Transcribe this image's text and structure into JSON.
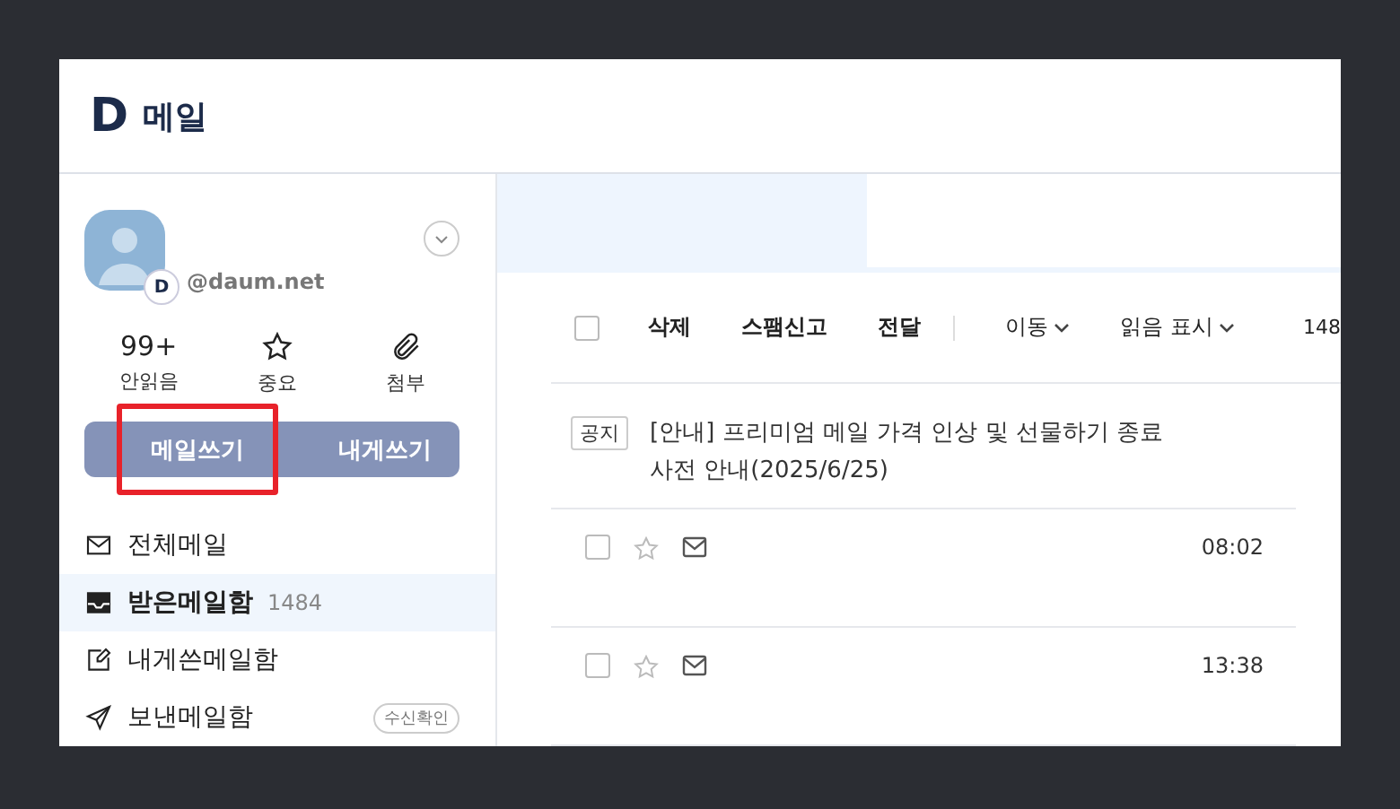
{
  "header": {
    "logo": "D",
    "title": "메일"
  },
  "profile": {
    "email": "@daum.net",
    "badge": "D"
  },
  "stats": [
    {
      "kind": "count",
      "value": "99+",
      "label": "안읽음"
    },
    {
      "kind": "star",
      "label": "중요"
    },
    {
      "kind": "clip",
      "label": "첨부"
    }
  ],
  "compose_buttons": [
    {
      "label": "메일쓰기",
      "highlighted": true
    },
    {
      "label": "내게쓰기",
      "highlighted": false
    }
  ],
  "folders": [
    {
      "kind": "mail",
      "label": "전체메일",
      "selected": false
    },
    {
      "kind": "inbox",
      "label": "받은메일함",
      "count": "1484",
      "selected": true
    },
    {
      "kind": "note",
      "label": "내게쓴메일함",
      "selected": false
    },
    {
      "kind": "send",
      "label": "보낸메일함",
      "badge": "수신확인",
      "selected": false
    }
  ],
  "toolbar": {
    "select_all_checked": false,
    "actions": [
      {
        "label": "삭제",
        "dropdown": false
      },
      {
        "label": "스팸신고",
        "dropdown": false
      },
      {
        "label": "전달",
        "dropdown": false
      },
      {
        "label": "이동",
        "dropdown": true
      },
      {
        "label": "읽음 표시",
        "dropdown": true
      }
    ],
    "count": "148"
  },
  "notice": {
    "tag": "공지",
    "text": "[안내] 프리미엄 메일 가격 인상 및 선물하기 종료 사전 안내(2025/6/25)"
  },
  "messages": [
    {
      "checked": false,
      "starred": false,
      "time": "08:02"
    },
    {
      "checked": false,
      "starred": false,
      "time": "13:38"
    }
  ]
}
